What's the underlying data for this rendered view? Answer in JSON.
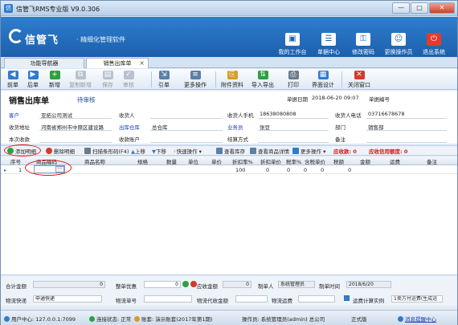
{
  "window": {
    "title": "信管飞RMS专业版 V9.0.306",
    "min": "—",
    "max": "□",
    "close": "✕"
  },
  "brand": {
    "logo": "信管飞",
    "slogan": "· 精细化管理软件"
  },
  "header_buttons": [
    {
      "label": "我的工作台",
      "icon": "desktop-icon"
    },
    {
      "label": "单据中心",
      "icon": "doc-center-icon"
    },
    {
      "label": "修改密码",
      "icon": "lock-icon"
    },
    {
      "label": "更换操作员",
      "icon": "user-icon"
    },
    {
      "label": "退出系统",
      "icon": "power-icon"
    }
  ],
  "tabs": [
    {
      "label": "功能导航器",
      "active": false
    },
    {
      "label": "销售出库单",
      "active": true
    }
  ],
  "toolbar": [
    {
      "label": "前单",
      "icon": "arrow-left-icon",
      "enabled": true
    },
    {
      "label": "后单",
      "icon": "arrow-right-icon",
      "enabled": true
    },
    {
      "label": "新增",
      "icon": "add-icon",
      "enabled": true
    },
    {
      "label": "复制新增",
      "icon": "copy-icon",
      "enabled": false
    },
    {
      "label": "保存",
      "icon": "save-icon",
      "enabled": false
    },
    {
      "label": "审核",
      "icon": "audit-icon",
      "enabled": false
    },
    {
      "label": "引单",
      "icon": "import-doc-icon",
      "enabled": true
    },
    {
      "label": "更多操作",
      "icon": "more-icon",
      "enabled": true
    },
    {
      "label": "附件资料",
      "icon": "attachment-icon",
      "enabled": true
    },
    {
      "label": "导入导出",
      "icon": "import-export-icon",
      "enabled": true
    },
    {
      "label": "打印",
      "icon": "print-icon",
      "enabled": true
    },
    {
      "label": "界面设计",
      "icon": "layout-icon",
      "enabled": true
    },
    {
      "label": "关闭窗口",
      "icon": "close-window-icon",
      "enabled": true
    }
  ],
  "doc": {
    "title": "销售出库单",
    "status": "待审核",
    "date_label": "单据日期",
    "date_value": "2018-06-20 09:07",
    "number_label": "单据编号",
    "number_value": ""
  },
  "fields": {
    "customer": {
      "label": "客户",
      "value": "亚拓公司测试"
    },
    "receiver": {
      "label": "收货人",
      "value": ""
    },
    "receiver_phone": {
      "label": "收货人手机",
      "value": "18638080808"
    },
    "receiver_tel": {
      "label": "收货人电话",
      "value": "03716678678"
    },
    "address": {
      "label": "收货地址",
      "value": "河南省郑州市中原区建设路"
    },
    "warehouse": {
      "label": "出库仓库",
      "value": "总仓库"
    },
    "salesman": {
      "label": "业务员",
      "value": "张豆"
    },
    "department": {
      "label": "部门",
      "value": "销售部"
    },
    "receipt": {
      "label": "本次收款",
      "value": ""
    },
    "account": {
      "label": "收款账户",
      "value": ""
    },
    "settle": {
      "label": "结算方式",
      "value": ""
    },
    "remark": {
      "label": "备注",
      "value": ""
    }
  },
  "grid_toolbar": {
    "add": "添加明细",
    "delete": "删除明细",
    "scan": "扫描条形码(F4)",
    "up": "上移",
    "down": "下移",
    "quick": "快速操作",
    "stock": "查看库存",
    "detail": "查看商品详情",
    "more": "更多操作",
    "receivable": "应收款: 0",
    "credit": "应收信用额度: 0"
  },
  "grid": {
    "columns": [
      "序号",
      "商品编码",
      "商品名称",
      "规格",
      "数量",
      "单位",
      "单价",
      "折扣率%",
      "折扣单价",
      "税率%",
      "含税单价",
      "税额",
      "金额",
      "运费",
      "备注"
    ],
    "rows": [
      {
        "index": "1",
        "marker": "▸",
        "code": "",
        "name": "",
        "spec": "",
        "qty": "",
        "unit": "",
        "price": "",
        "discount": "100",
        "disc_price": "0",
        "tax_rate": "0",
        "tax_price": "0",
        "tax": "0",
        "amount": "0",
        "freight": "",
        "remark": ""
      }
    ]
  },
  "footer": {
    "total_label": "合计金额",
    "total_value": "0",
    "discount_label": "整单优惠",
    "discount_value": "0",
    "receivable_label": "应收金额",
    "receivable_value": "0",
    "maker_label": "制单人",
    "maker_value": "系统管理员",
    "make_date_label": "制单时间",
    "make_date_value": "2018/6/20",
    "express_label": "物流快递",
    "express_value": "申通快递",
    "express_no_label": "物流单号",
    "express_no_value": "",
    "cod_label": "物流代收金额",
    "cod_value": "",
    "freight_label": "物流运费",
    "freight_value": "",
    "freight_calc_label": "运费计算实例",
    "freight_calc_value": "1卖方付运费(生成运"
  },
  "status": {
    "user_center": "用户中心: 127.0.0.1:7099",
    "conn": "连接状态: 正常",
    "book": "账套: 演示账套(2017年第1期)",
    "operator": "操作员: 系统管理员(admin) 总公司",
    "edition": "正式版",
    "msg": "消息提醒中心"
  }
}
